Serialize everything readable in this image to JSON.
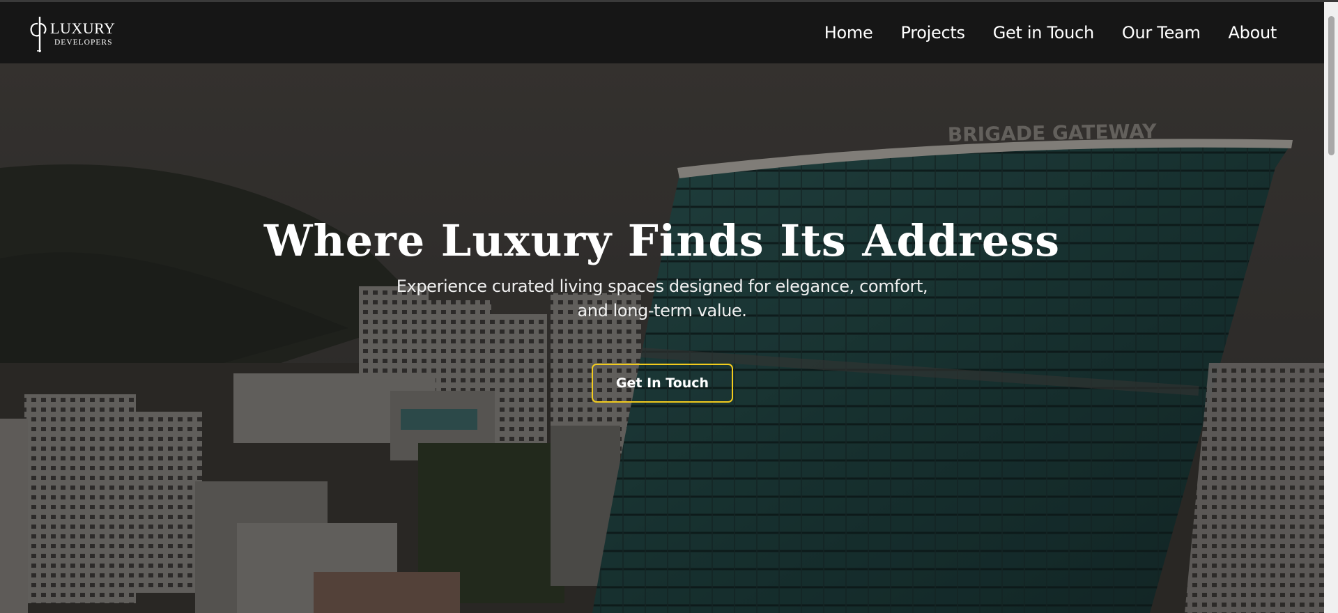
{
  "brand": {
    "logo_line1": "LUXURY",
    "logo_line2": "DEVELOPERS"
  },
  "nav": {
    "items": [
      {
        "label": "Home"
      },
      {
        "label": "Projects"
      },
      {
        "label": "Get in Touch"
      },
      {
        "label": "Our Team"
      },
      {
        "label": "About"
      }
    ]
  },
  "hero": {
    "title": "Where Luxury Finds Its Address",
    "subtitle": "Experience curated living spaces designed for elegance, comfort, and long-term value.",
    "cta_label": "Get In Touch",
    "background_text": "BRIGADE GATEWAY"
  },
  "colors": {
    "navbar_bg": "#161616",
    "accent": "#f2cb1d",
    "text": "#ffffff"
  }
}
